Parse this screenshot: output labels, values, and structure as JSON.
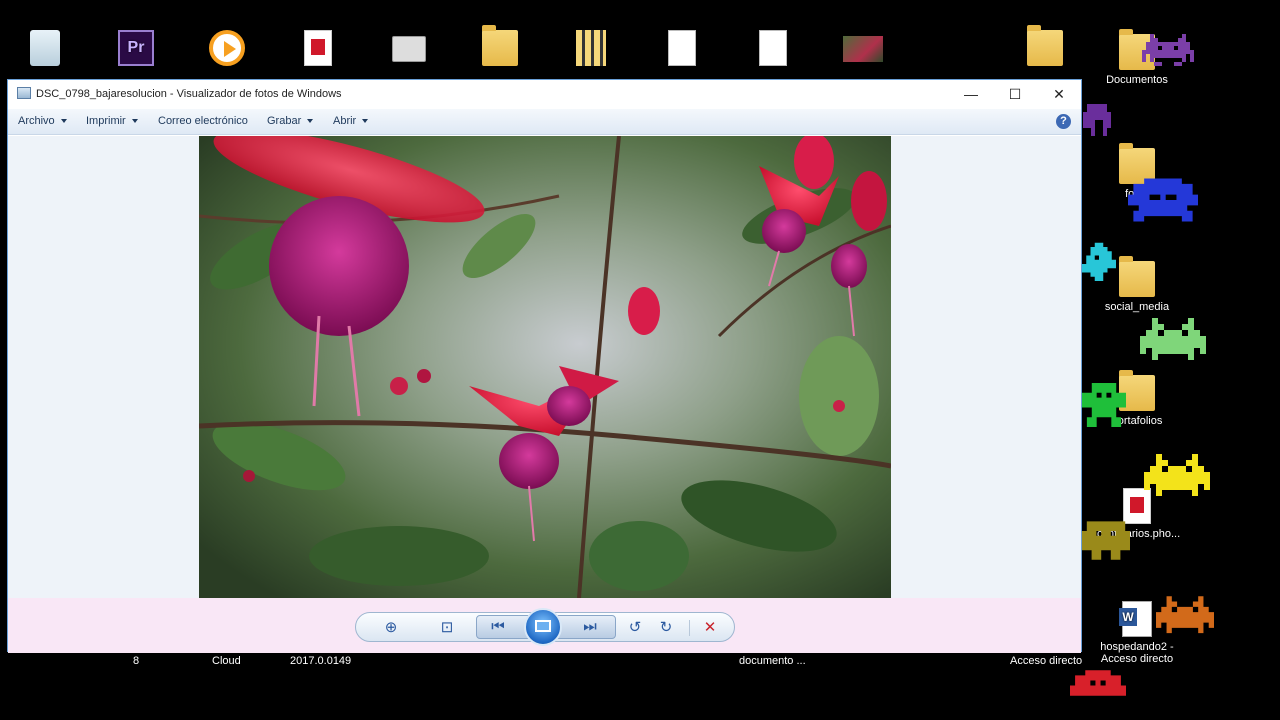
{
  "window": {
    "title": "DSC_0798_bajaresolucion - Visualizador de fotos de Windows",
    "controls": {
      "minimize": "—",
      "maximize": "☐",
      "close": "✕"
    }
  },
  "menu": {
    "items": [
      "Archivo",
      "Imprimir",
      "Correo electrónico",
      "Grabar",
      "Abrir"
    ],
    "help": "?"
  },
  "photo": {
    "subject": "fuchsia flowers"
  },
  "toolbar": {
    "zoom": "⊕",
    "fit": "⊡",
    "previous": "⏮",
    "next": "⏭",
    "rotate_left": "↺",
    "rotate_right": "↻",
    "delete": "✕"
  },
  "desktop": {
    "labels": {
      "documentos": "Documentos",
      "fotos": "fotos",
      "social_media": "social_media",
      "portafolios": "portafolios",
      "cynthiarios": "cynthiarios.pho...",
      "hospedando_line1": "hospedando2 -",
      "hospedando_line2": "Acceso directo"
    },
    "taskbar_fragments": [
      "8",
      "Cloud",
      "2017.0.0149",
      "documento ...",
      "Acceso directo"
    ]
  },
  "colors": {
    "window_border": "#6aa0d8",
    "menubar": "#dfe9f5",
    "controls_bg": "#f9e7f6",
    "accent": "#2c5aa0",
    "delete": "#c8242c"
  }
}
